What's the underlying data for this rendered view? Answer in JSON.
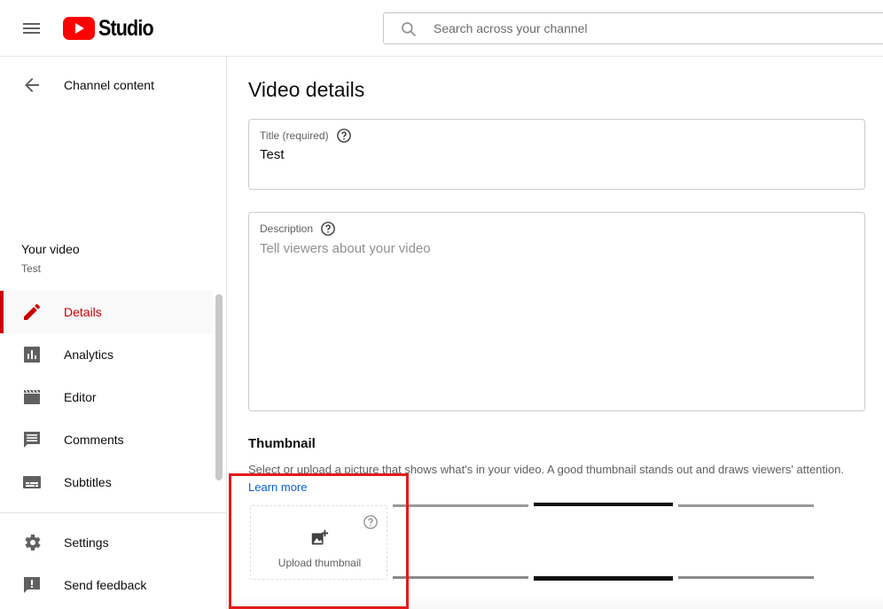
{
  "header": {
    "logo_text": "Studio",
    "search_placeholder": "Search across your channel",
    "brand_color": "#ff0000"
  },
  "sidebar": {
    "back_label": "Channel content",
    "video_heading": "Your video",
    "video_name": "Test",
    "items": [
      {
        "label": "Details",
        "icon": "pencil-icon",
        "active": true
      },
      {
        "label": "Analytics",
        "icon": "analytics-icon",
        "active": false
      },
      {
        "label": "Editor",
        "icon": "clapperboard-icon",
        "active": false
      },
      {
        "label": "Comments",
        "icon": "comment-icon",
        "active": false
      },
      {
        "label": "Subtitles",
        "icon": "subtitles-icon",
        "active": false
      }
    ],
    "footer_items": [
      {
        "label": "Settings",
        "icon": "gear-icon"
      },
      {
        "label": "Send feedback",
        "icon": "feedback-icon"
      }
    ],
    "active_color": "#cc0000"
  },
  "main": {
    "page_title": "Video details",
    "title_field": {
      "label": "Title (required)",
      "value": "Test"
    },
    "description_field": {
      "label": "Description",
      "placeholder": "Tell viewers about your video"
    },
    "thumbnail": {
      "heading": "Thumbnail",
      "description": "Select or upload a picture that shows what's in your video. A good thumbnail stands out and draws viewers' attention.",
      "learn_more": "Learn more",
      "upload_label": "Upload thumbnail"
    },
    "link_color": "#065fd4",
    "highlight_color": "#e41a1a"
  }
}
